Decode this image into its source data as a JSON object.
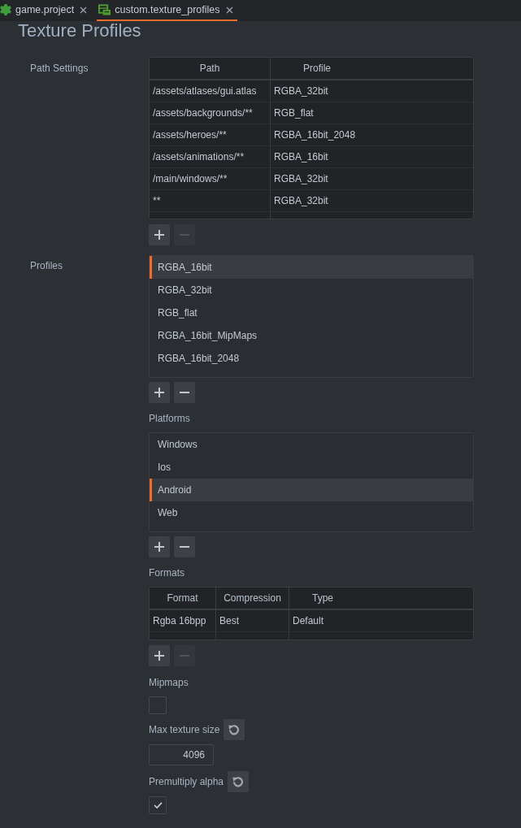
{
  "tabs": [
    {
      "kind": "project",
      "label": "game.project",
      "selected": false
    },
    {
      "kind": "texture_profiles",
      "label": "custom.texture_profiles",
      "selected": true
    }
  ],
  "title": "Texture Profiles",
  "path_settings": {
    "label": "Path Settings",
    "columns": [
      "Path",
      "Profile"
    ],
    "rows": [
      [
        "/assets/atlases/gui.atlas",
        "RGBA_32bit"
      ],
      [
        "/assets/backgrounds/**",
        "RGB_flat"
      ],
      [
        "/assets/heroes/**",
        "RGBA_16bit_2048"
      ],
      [
        "/assets/animations/**",
        "RGBA_16bit"
      ],
      [
        "/main/windows/**",
        "RGBA_32bit"
      ],
      [
        "**",
        "RGBA_32bit"
      ]
    ],
    "buttons": [
      {
        "kind": "add",
        "disabled": false
      },
      {
        "kind": "remove",
        "disabled": true
      }
    ]
  },
  "profiles": {
    "label": "Profiles",
    "items": [
      {
        "label": "RGBA_16bit",
        "selected": true
      },
      {
        "label": "RGBA_32bit",
        "selected": false
      },
      {
        "label": "RGB_flat",
        "selected": false
      },
      {
        "label": "RGBA_16bit_MipMaps",
        "selected": false
      },
      {
        "label": "RGBA_16bit_2048",
        "selected": false
      }
    ],
    "buttons": [
      {
        "kind": "add",
        "disabled": false
      },
      {
        "kind": "remove",
        "disabled": false
      }
    ]
  },
  "platforms": {
    "label": "Platforms",
    "items": [
      {
        "label": "Windows",
        "selected": false
      },
      {
        "label": "Ios",
        "selected": false
      },
      {
        "label": "Android",
        "selected": true
      },
      {
        "label": "Web",
        "selected": false
      }
    ],
    "buttons": [
      {
        "kind": "add",
        "disabled": false
      },
      {
        "kind": "remove",
        "disabled": false
      }
    ]
  },
  "formats": {
    "label": "Formats",
    "columns": [
      "Format",
      "Compression",
      "Type"
    ],
    "rows": [
      [
        "Rgba 16bpp",
        "Best",
        "Default"
      ]
    ],
    "buttons": [
      {
        "kind": "add",
        "disabled": false
      },
      {
        "kind": "remove",
        "disabled": true
      }
    ]
  },
  "mipmaps": {
    "label": "Mipmaps",
    "checked": false
  },
  "max_texture_size": {
    "label": "Max texture size",
    "value": "4096"
  },
  "premultiply_alpha": {
    "label": "Premultiply alpha",
    "checked": true
  }
}
